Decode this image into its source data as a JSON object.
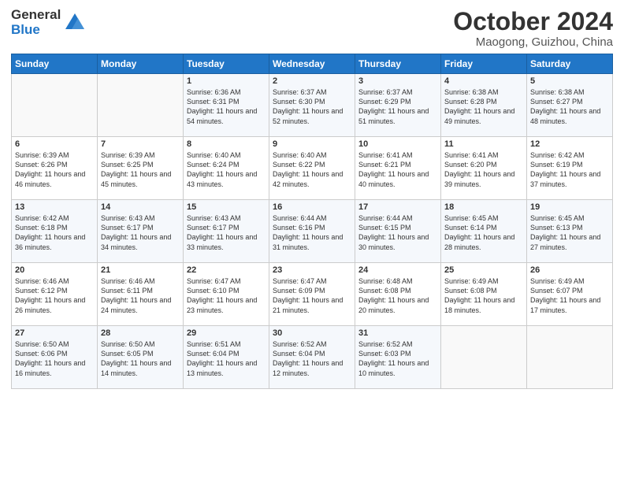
{
  "header": {
    "logo_general": "General",
    "logo_blue": "Blue",
    "month_title": "October 2024",
    "location": "Maogong, Guizhou, China"
  },
  "weekdays": [
    "Sunday",
    "Monday",
    "Tuesday",
    "Wednesday",
    "Thursday",
    "Friday",
    "Saturday"
  ],
  "weeks": [
    [
      {
        "day": "",
        "sunrise": "",
        "sunset": "",
        "daylight": ""
      },
      {
        "day": "",
        "sunrise": "",
        "sunset": "",
        "daylight": ""
      },
      {
        "day": "1",
        "sunrise": "Sunrise: 6:36 AM",
        "sunset": "Sunset: 6:31 PM",
        "daylight": "Daylight: 11 hours and 54 minutes."
      },
      {
        "day": "2",
        "sunrise": "Sunrise: 6:37 AM",
        "sunset": "Sunset: 6:30 PM",
        "daylight": "Daylight: 11 hours and 52 minutes."
      },
      {
        "day": "3",
        "sunrise": "Sunrise: 6:37 AM",
        "sunset": "Sunset: 6:29 PM",
        "daylight": "Daylight: 11 hours and 51 minutes."
      },
      {
        "day": "4",
        "sunrise": "Sunrise: 6:38 AM",
        "sunset": "Sunset: 6:28 PM",
        "daylight": "Daylight: 11 hours and 49 minutes."
      },
      {
        "day": "5",
        "sunrise": "Sunrise: 6:38 AM",
        "sunset": "Sunset: 6:27 PM",
        "daylight": "Daylight: 11 hours and 48 minutes."
      }
    ],
    [
      {
        "day": "6",
        "sunrise": "Sunrise: 6:39 AM",
        "sunset": "Sunset: 6:26 PM",
        "daylight": "Daylight: 11 hours and 46 minutes."
      },
      {
        "day": "7",
        "sunrise": "Sunrise: 6:39 AM",
        "sunset": "Sunset: 6:25 PM",
        "daylight": "Daylight: 11 hours and 45 minutes."
      },
      {
        "day": "8",
        "sunrise": "Sunrise: 6:40 AM",
        "sunset": "Sunset: 6:24 PM",
        "daylight": "Daylight: 11 hours and 43 minutes."
      },
      {
        "day": "9",
        "sunrise": "Sunrise: 6:40 AM",
        "sunset": "Sunset: 6:22 PM",
        "daylight": "Daylight: 11 hours and 42 minutes."
      },
      {
        "day": "10",
        "sunrise": "Sunrise: 6:41 AM",
        "sunset": "Sunset: 6:21 PM",
        "daylight": "Daylight: 11 hours and 40 minutes."
      },
      {
        "day": "11",
        "sunrise": "Sunrise: 6:41 AM",
        "sunset": "Sunset: 6:20 PM",
        "daylight": "Daylight: 11 hours and 39 minutes."
      },
      {
        "day": "12",
        "sunrise": "Sunrise: 6:42 AM",
        "sunset": "Sunset: 6:19 PM",
        "daylight": "Daylight: 11 hours and 37 minutes."
      }
    ],
    [
      {
        "day": "13",
        "sunrise": "Sunrise: 6:42 AM",
        "sunset": "Sunset: 6:18 PM",
        "daylight": "Daylight: 11 hours and 36 minutes."
      },
      {
        "day": "14",
        "sunrise": "Sunrise: 6:43 AM",
        "sunset": "Sunset: 6:17 PM",
        "daylight": "Daylight: 11 hours and 34 minutes."
      },
      {
        "day": "15",
        "sunrise": "Sunrise: 6:43 AM",
        "sunset": "Sunset: 6:17 PM",
        "daylight": "Daylight: 11 hours and 33 minutes."
      },
      {
        "day": "16",
        "sunrise": "Sunrise: 6:44 AM",
        "sunset": "Sunset: 6:16 PM",
        "daylight": "Daylight: 11 hours and 31 minutes."
      },
      {
        "day": "17",
        "sunrise": "Sunrise: 6:44 AM",
        "sunset": "Sunset: 6:15 PM",
        "daylight": "Daylight: 11 hours and 30 minutes."
      },
      {
        "day": "18",
        "sunrise": "Sunrise: 6:45 AM",
        "sunset": "Sunset: 6:14 PM",
        "daylight": "Daylight: 11 hours and 28 minutes."
      },
      {
        "day": "19",
        "sunrise": "Sunrise: 6:45 AM",
        "sunset": "Sunset: 6:13 PM",
        "daylight": "Daylight: 11 hours and 27 minutes."
      }
    ],
    [
      {
        "day": "20",
        "sunrise": "Sunrise: 6:46 AM",
        "sunset": "Sunset: 6:12 PM",
        "daylight": "Daylight: 11 hours and 26 minutes."
      },
      {
        "day": "21",
        "sunrise": "Sunrise: 6:46 AM",
        "sunset": "Sunset: 6:11 PM",
        "daylight": "Daylight: 11 hours and 24 minutes."
      },
      {
        "day": "22",
        "sunrise": "Sunrise: 6:47 AM",
        "sunset": "Sunset: 6:10 PM",
        "daylight": "Daylight: 11 hours and 23 minutes."
      },
      {
        "day": "23",
        "sunrise": "Sunrise: 6:47 AM",
        "sunset": "Sunset: 6:09 PM",
        "daylight": "Daylight: 11 hours and 21 minutes."
      },
      {
        "day": "24",
        "sunrise": "Sunrise: 6:48 AM",
        "sunset": "Sunset: 6:08 PM",
        "daylight": "Daylight: 11 hours and 20 minutes."
      },
      {
        "day": "25",
        "sunrise": "Sunrise: 6:49 AM",
        "sunset": "Sunset: 6:08 PM",
        "daylight": "Daylight: 11 hours and 18 minutes."
      },
      {
        "day": "26",
        "sunrise": "Sunrise: 6:49 AM",
        "sunset": "Sunset: 6:07 PM",
        "daylight": "Daylight: 11 hours and 17 minutes."
      }
    ],
    [
      {
        "day": "27",
        "sunrise": "Sunrise: 6:50 AM",
        "sunset": "Sunset: 6:06 PM",
        "daylight": "Daylight: 11 hours and 16 minutes."
      },
      {
        "day": "28",
        "sunrise": "Sunrise: 6:50 AM",
        "sunset": "Sunset: 6:05 PM",
        "daylight": "Daylight: 11 hours and 14 minutes."
      },
      {
        "day": "29",
        "sunrise": "Sunrise: 6:51 AM",
        "sunset": "Sunset: 6:04 PM",
        "daylight": "Daylight: 11 hours and 13 minutes."
      },
      {
        "day": "30",
        "sunrise": "Sunrise: 6:52 AM",
        "sunset": "Sunset: 6:04 PM",
        "daylight": "Daylight: 11 hours and 12 minutes."
      },
      {
        "day": "31",
        "sunrise": "Sunrise: 6:52 AM",
        "sunset": "Sunset: 6:03 PM",
        "daylight": "Daylight: 11 hours and 10 minutes."
      },
      {
        "day": "",
        "sunrise": "",
        "sunset": "",
        "daylight": ""
      },
      {
        "day": "",
        "sunrise": "",
        "sunset": "",
        "daylight": ""
      }
    ]
  ]
}
